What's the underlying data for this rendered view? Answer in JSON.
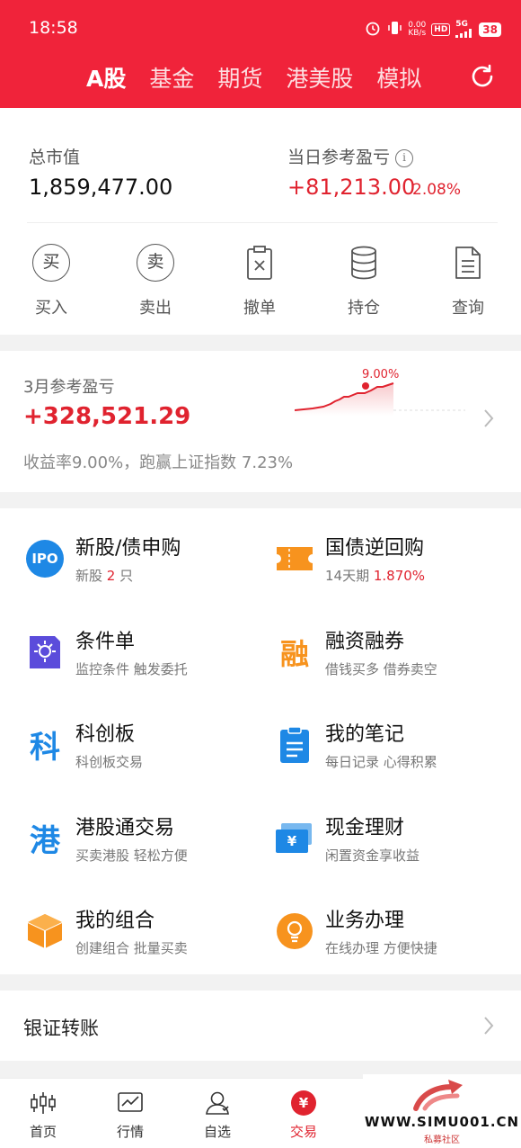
{
  "status": {
    "time": "18:58",
    "net_speed_top": "0.00",
    "net_speed_bottom": "KB/s",
    "hd": "HD",
    "signal": "5G",
    "battery": "38"
  },
  "tabs": [
    "A股",
    "基金",
    "期货",
    "港美股",
    "模拟"
  ],
  "summary": {
    "market_value_label": "总市值",
    "market_value": "1,859,477.00",
    "daily_pl_label": "当日参考盈亏",
    "daily_pl": "+81,213.00",
    "daily_pl_pct": "2.08%",
    "info_icon": "i"
  },
  "actions": [
    {
      "label": "买入",
      "icon_char": "买"
    },
    {
      "label": "卖出",
      "icon_char": "卖"
    },
    {
      "label": "撤单"
    },
    {
      "label": "持仓"
    },
    {
      "label": "查询"
    }
  ],
  "monthly": {
    "label": "3月参考盈亏",
    "value": "+328,521.29",
    "desc": "收益率9.00%，跑赢上证指数 7.23%",
    "chart_end_label": "9.00%"
  },
  "services": [
    {
      "title": "新股/债申购",
      "sub_prefix": "新股 ",
      "sub_highlight": "2",
      "sub_suffix": " 只",
      "icon": "ipo-icon",
      "icon_text": "IPO"
    },
    {
      "title": "国债逆回购",
      "sub_prefix": "14天期 ",
      "sub_highlight": "1.870%",
      "sub_suffix": "",
      "icon": "ticket-icon"
    },
    {
      "title": "条件单",
      "sub": "监控条件 触发委托",
      "icon": "condition-order-icon"
    },
    {
      "title": "融资融券",
      "sub": "借钱买多 借券卖空",
      "icon": "margin-icon",
      "icon_text": "融"
    },
    {
      "title": "科创板",
      "sub": "科创板交易",
      "icon": "star-market-icon",
      "icon_text": "科"
    },
    {
      "title": "我的笔记",
      "sub": "每日记录 心得积累",
      "icon": "notes-icon"
    },
    {
      "title": "港股通交易",
      "sub": "买卖港股 轻松方便",
      "icon": "hk-connect-icon",
      "icon_text": "港"
    },
    {
      "title": "现金理财",
      "sub": "闲置资金享收益",
      "icon": "cash-icon",
      "icon_text": "¥"
    },
    {
      "title": "我的组合",
      "sub": "创建组合 批量买卖",
      "icon": "portfolio-icon"
    },
    {
      "title": "业务办理",
      "sub": "在线办理 方便快捷",
      "icon": "business-icon"
    }
  ],
  "transfer_label": "银证转账",
  "bottom_nav": [
    {
      "label": "首页"
    },
    {
      "label": "行情"
    },
    {
      "label": "自选"
    },
    {
      "label": "交易",
      "icon_char": "¥"
    }
  ],
  "watermark": {
    "text": "WWW.SIMU001.CN",
    "sub": "私募社区"
  },
  "colors": {
    "brand_red": "#f0233a",
    "profit_red": "#e0232f",
    "blue": "#1e88e5",
    "orange": "#f7931e",
    "purple": "#5b4cdb"
  }
}
